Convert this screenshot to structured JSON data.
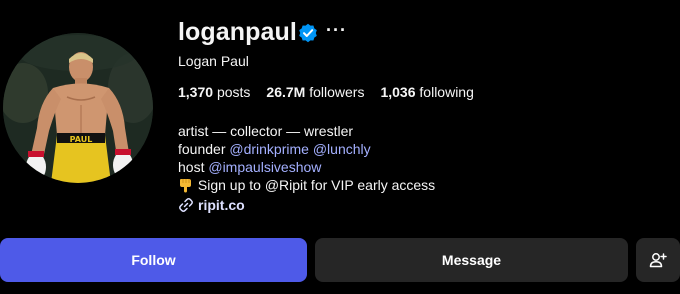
{
  "profile": {
    "username": "loganpaul",
    "full_name": "Logan Paul",
    "verified": true,
    "more_label": "···"
  },
  "stats": {
    "posts_count": "1,370",
    "posts_label": "posts",
    "followers_count": "26.7M",
    "followers_label": "followers",
    "following_count": "1,036",
    "following_label": "following"
  },
  "bio": {
    "line1": "artist — collector — wrestler",
    "line2_prefix": "founder",
    "line2_mention1": "@drinkprime",
    "line2_mention2": "@lunchly",
    "line3_prefix": "host",
    "line3_mention": "@impaulsiveshow",
    "line4": "Sign up to @Ripit for VIP early access",
    "link": "ripit.co"
  },
  "actions": {
    "follow_label": "Follow",
    "message_label": "Message"
  },
  "icons": {
    "verified": "verified-badge-icon",
    "more": "more-options-icon",
    "link": "link-icon",
    "hand": "pointing-down-hand-emoji",
    "add_user": "add-user-icon"
  },
  "colors": {
    "background": "#000000",
    "follow_button": "#4e5ae8",
    "secondary_button": "#262626",
    "mention": "#a4b0ff",
    "verified": "#0095f6"
  }
}
